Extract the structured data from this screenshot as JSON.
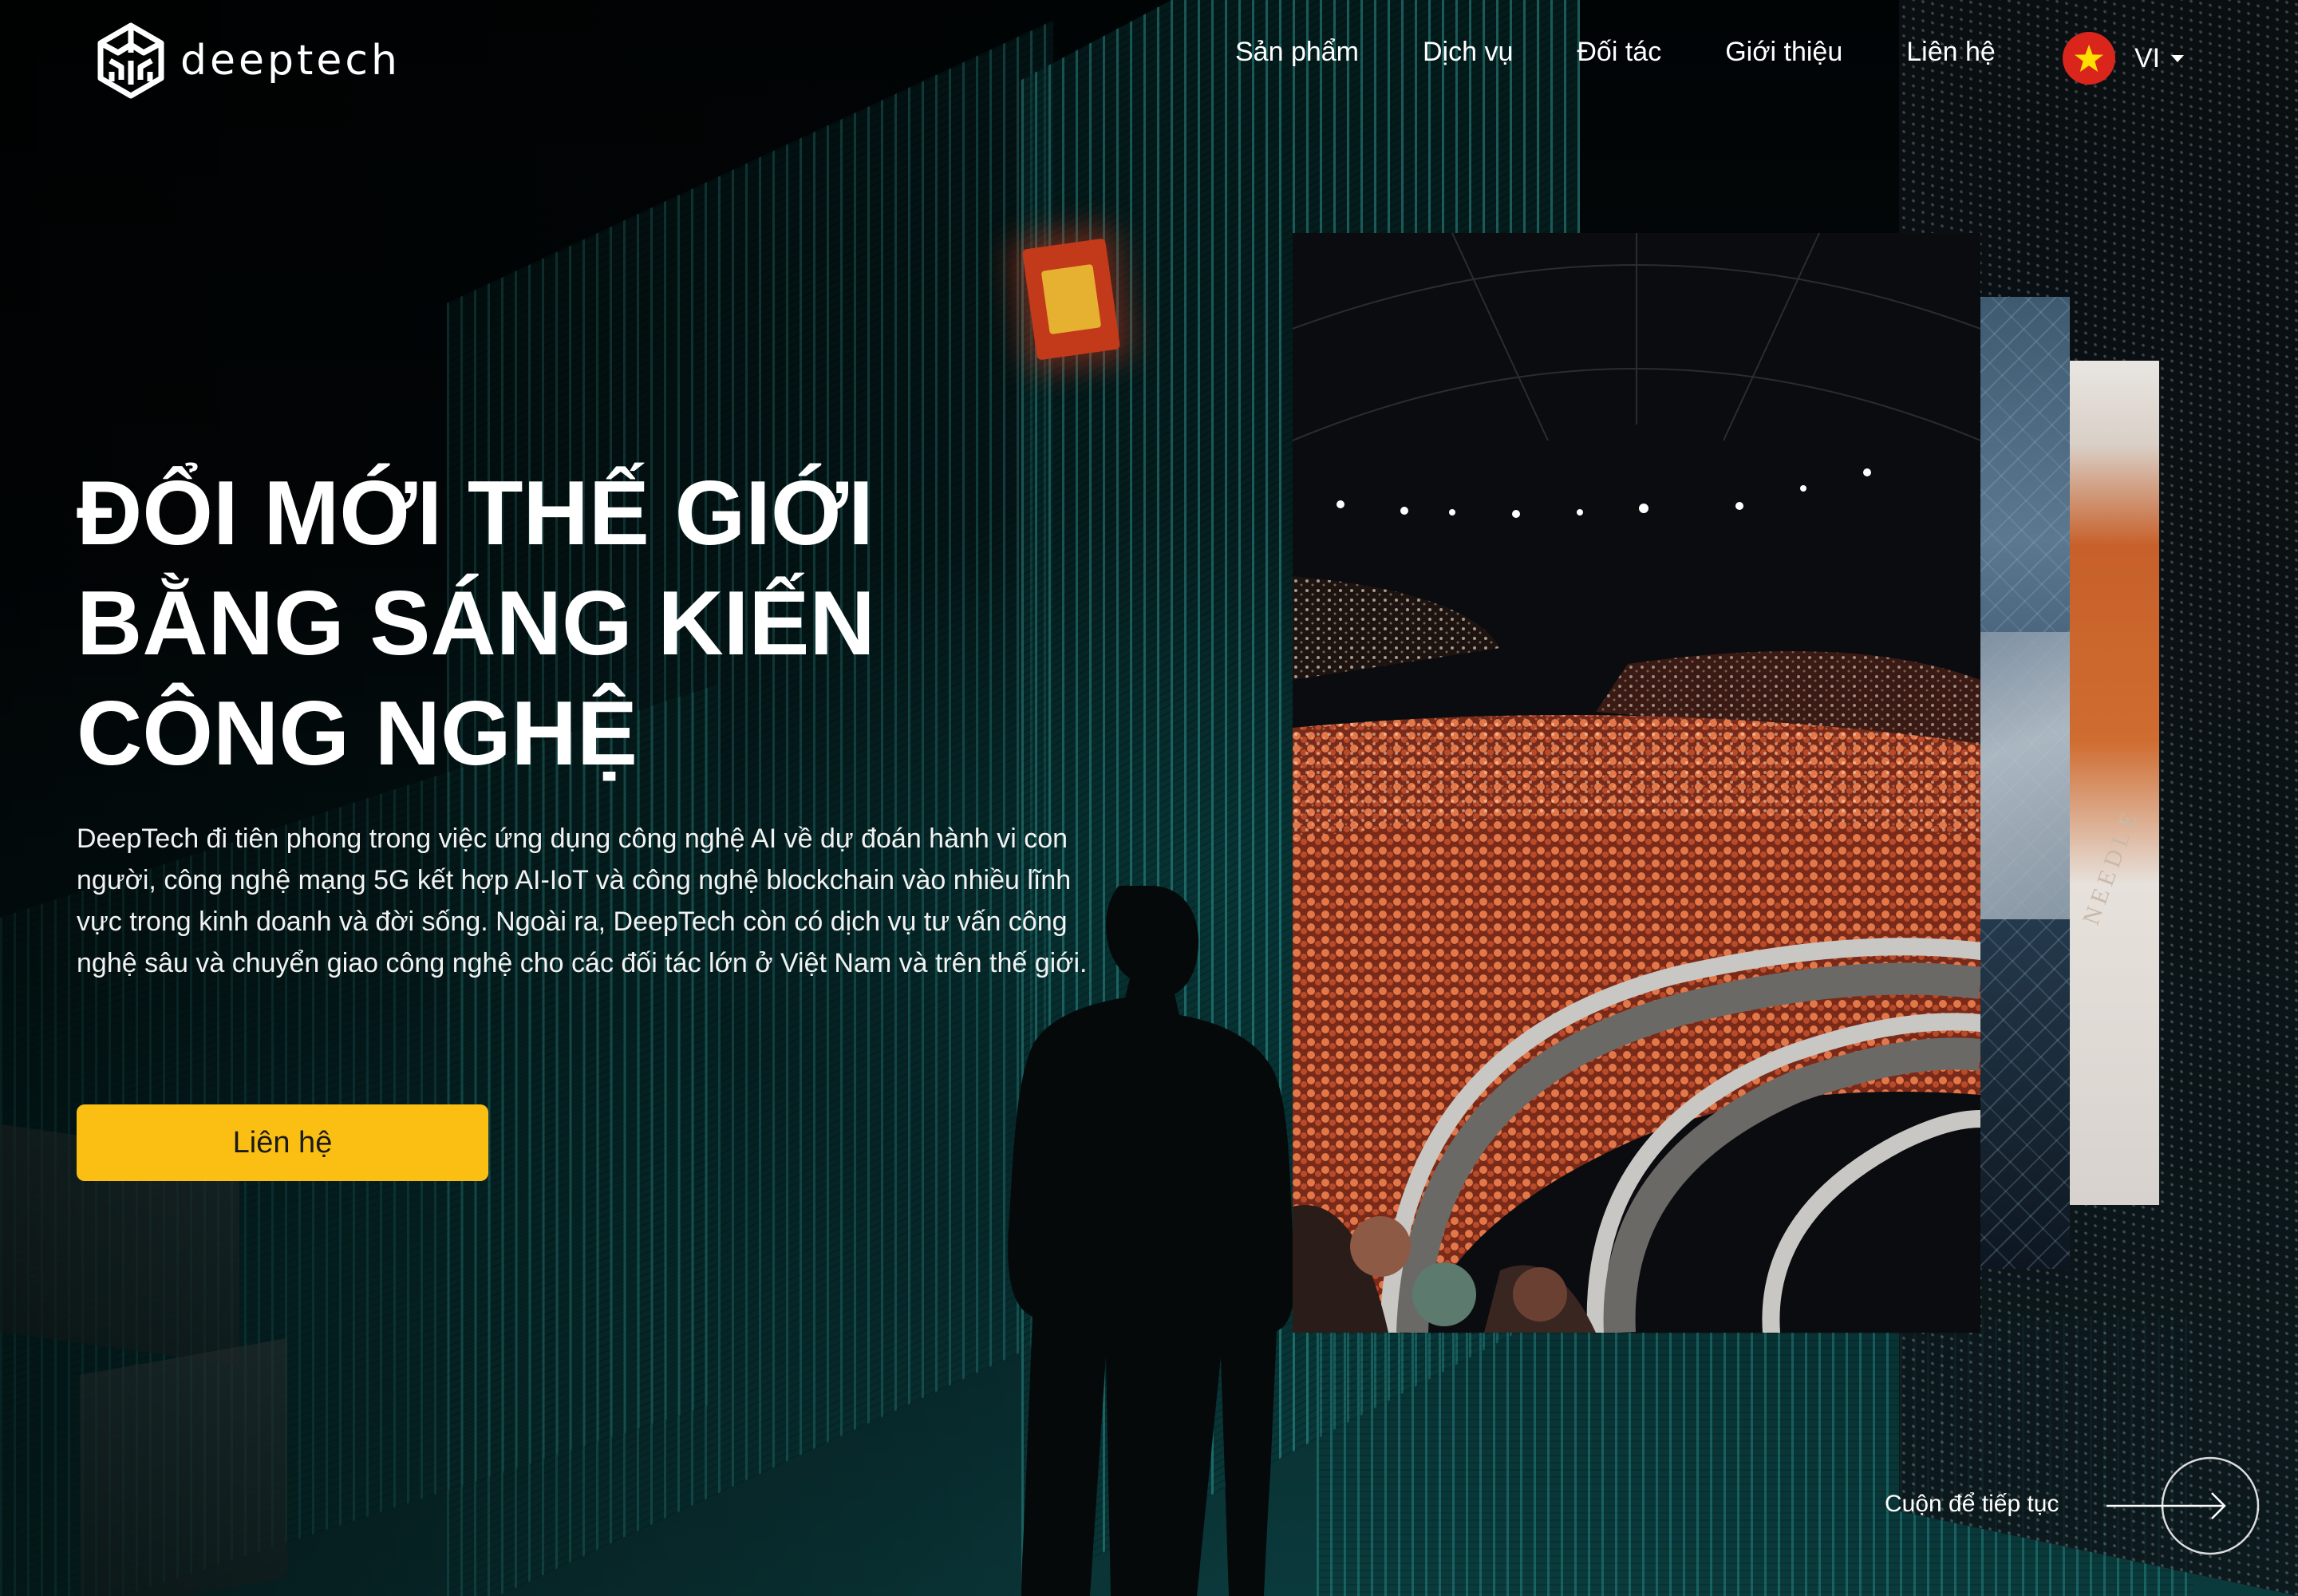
{
  "brand": {
    "name": "deeptech"
  },
  "nav": {
    "items": [
      "Sản phẩm",
      "Dịch vụ",
      "Đối tác",
      "Giới thiệu",
      "Liên hệ"
    ]
  },
  "language": {
    "code": "VI",
    "flag_color": "#da251d",
    "star_color": "#ffde00"
  },
  "hero": {
    "title_lines": [
      "ĐỔI MỚI THẾ GIỚI",
      "BẰNG SÁNG KIẾN",
      "CÔNG NGHỆ"
    ],
    "description": "DeepTech đi tiên phong trong việc ứng dụng công nghệ AI về dự đoán hành vi con người, công nghệ mạng 5G kết hợp AI-IoT và công nghệ blockchain vào nhiều lĩnh vực trong kinh doanh và đời sống. Ngoài ra, DeepTech còn có dịch vụ tư vấn công nghệ sâu và chuyển giao công nghệ cho các đối tác lớn ở Việt Nam và trên thế giới.",
    "cta_label": "Liên hệ",
    "cta_color": "#fbbf14"
  },
  "gallery": {
    "cards": [
      "concert-photo",
      "circuit-board-photo",
      "needle-packaging-photo"
    ],
    "needle_text": "NEEDLE"
  },
  "scroll": {
    "label": "Cuộn để tiếp tục"
  }
}
